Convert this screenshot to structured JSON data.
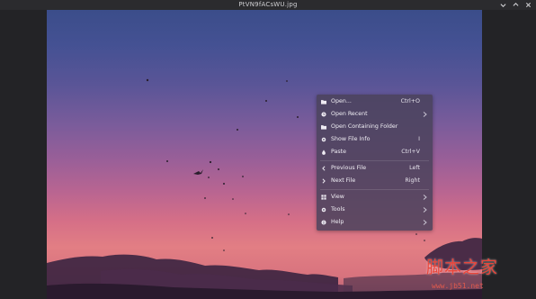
{
  "window": {
    "title": "PtVN9fACsWU.jpg",
    "controls": [
      {
        "name": "minimize-button",
        "icon": "chevron-down-icon"
      },
      {
        "name": "maximize-button",
        "icon": "chevron-up-icon"
      },
      {
        "name": "close-button",
        "icon": "close-icon"
      }
    ]
  },
  "context_menu": {
    "items": [
      {
        "label": "Open...",
        "shortcut": "Ctrl+O",
        "icon": "folder-icon",
        "submenu": false
      },
      {
        "label": "Open Recent",
        "shortcut": "",
        "icon": "clock-icon",
        "submenu": true
      },
      {
        "label": "Open Containing Folder",
        "shortcut": "",
        "icon": "folder-icon",
        "submenu": false
      },
      {
        "label": "Show File Info",
        "shortcut": "I",
        "icon": "gear-icon",
        "submenu": false
      },
      {
        "label": "Paste",
        "shortcut": "Ctrl+V",
        "icon": "paste-icon",
        "submenu": false
      },
      {
        "label": "Previous File",
        "shortcut": "Left",
        "icon": "chevron-left-icon",
        "submenu": false
      },
      {
        "label": "Next File",
        "shortcut": "Right",
        "icon": "chevron-right-icon",
        "submenu": false
      },
      {
        "label": "View",
        "shortcut": "",
        "icon": "view-icon",
        "submenu": true
      },
      {
        "label": "Tools",
        "shortcut": "",
        "icon": "gear-icon",
        "submenu": true
      },
      {
        "label": "Help",
        "shortcut": "",
        "icon": "info-icon",
        "submenu": true
      }
    ]
  },
  "watermark": {
    "text": "脚本之家",
    "url": "www.jb51.net"
  },
  "colors": {
    "titlebar": "#2b2b2e",
    "menu_background": "#4a425c",
    "sky_top": "#3b4d8a",
    "sky_bottom": "#d8737e",
    "watermark": "#e9453a"
  }
}
